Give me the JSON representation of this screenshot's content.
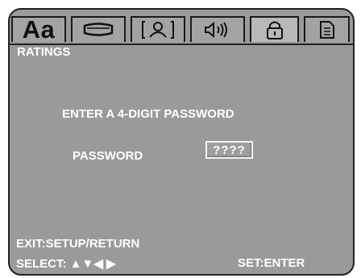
{
  "tabs": [
    {
      "name": "language",
      "icon": "text-aa-icon",
      "text": "Aa"
    },
    {
      "name": "video",
      "icon": "video-screen-icon"
    },
    {
      "name": "display",
      "icon": "person-display-icon"
    },
    {
      "name": "audio",
      "icon": "speaker-icon"
    },
    {
      "name": "ratings",
      "icon": "lock-icon",
      "active": true
    },
    {
      "name": "misc",
      "icon": "sd-card-icon"
    }
  ],
  "section": {
    "title": "RATINGS"
  },
  "prompt": "ENTER A 4-DIGIT PASSWORD",
  "password": {
    "label": "PASSWORD",
    "value": "????"
  },
  "hints": {
    "exit": "EXIT:SETUP/RETURN",
    "select": "SELECT: ▲▼◀ ▶",
    "set": "SET:ENTER"
  },
  "colors": {
    "background": "#9a9a9a",
    "text": "#ffffff",
    "active_tab": "#b8b8b8"
  }
}
